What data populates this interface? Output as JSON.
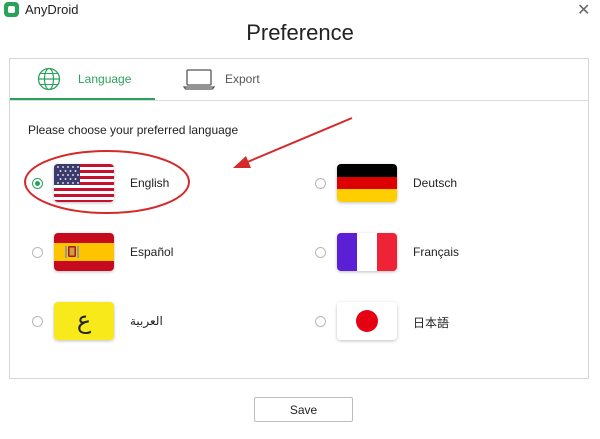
{
  "window": {
    "app_name": "AnyDroid",
    "close_glyph": "✕"
  },
  "dialog": {
    "title": "Preference"
  },
  "tabs": [
    {
      "label": "Language",
      "icon": "globe-icon",
      "active": true
    },
    {
      "label": "Export",
      "icon": "laptop-icon",
      "active": false
    }
  ],
  "prompt": "Please choose your preferred language",
  "languages": [
    {
      "label": "English",
      "flag": "us-flag",
      "selected": true
    },
    {
      "label": "Deutsch",
      "flag": "germany-flag",
      "selected": false
    },
    {
      "label": "Español",
      "flag": "spain-flag",
      "selected": false
    },
    {
      "label": "Français",
      "flag": "france-flag",
      "selected": false
    },
    {
      "label": "العربية",
      "flag": "arabic-flag",
      "flag_text": "ع",
      "selected": false
    },
    {
      "label": "日本語",
      "flag": "japan-flag",
      "selected": false
    }
  ],
  "save_label": "Save",
  "colors": {
    "accent": "#2aa35a",
    "annotation": "#d42a2a"
  }
}
